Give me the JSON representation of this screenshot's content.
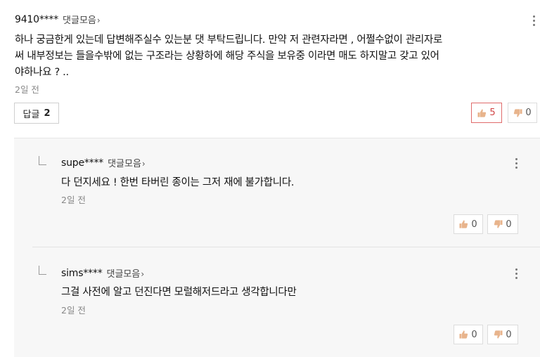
{
  "comment": {
    "user": "9410****",
    "collect_label": "댓글모음",
    "text_lines": [
      "하나 궁금한게 있는데 답변해주실수 있는분 댓 부탁드립니다. 만약 저 관련자라면 , 어쩔수없이 관리자로",
      "써 내부정보는 들을수밖에 없는 구조라는 상황하에 해당 주식을 보유중 이라면 매도 하지말고 갖고 있어",
      "야하나요 ? .."
    ],
    "date": "2일 전",
    "reply_label": "답글",
    "reply_count": "2",
    "likes": "5",
    "dislikes": "0"
  },
  "replies": [
    {
      "user": "supe****",
      "collect_label": "댓글모음",
      "text": "다 던지세요 ! 한번 타버린 종이는 그저 재에 불가합니다.",
      "date": "2일 전",
      "likes": "0",
      "dislikes": "0"
    },
    {
      "user": "sims****",
      "collect_label": "댓글모음",
      "text": "그걸 사전에 알고 던진다면 모럴해저드라고 생각합니다만",
      "date": "2일 전",
      "likes": "0",
      "dislikes": "0"
    }
  ],
  "icons": {
    "chevron": "chevron-right-icon",
    "more": "more-vertical-icon",
    "like": "thumbs-up-icon",
    "dislike": "thumbs-down-icon",
    "reply_indent": "reply-indent-icon"
  },
  "colors": {
    "like_active_border": "#e06b6b",
    "like_active_text": "#d14444",
    "thumb_fill": "#e8b48c",
    "reply_bg": "#f7f7f7"
  }
}
